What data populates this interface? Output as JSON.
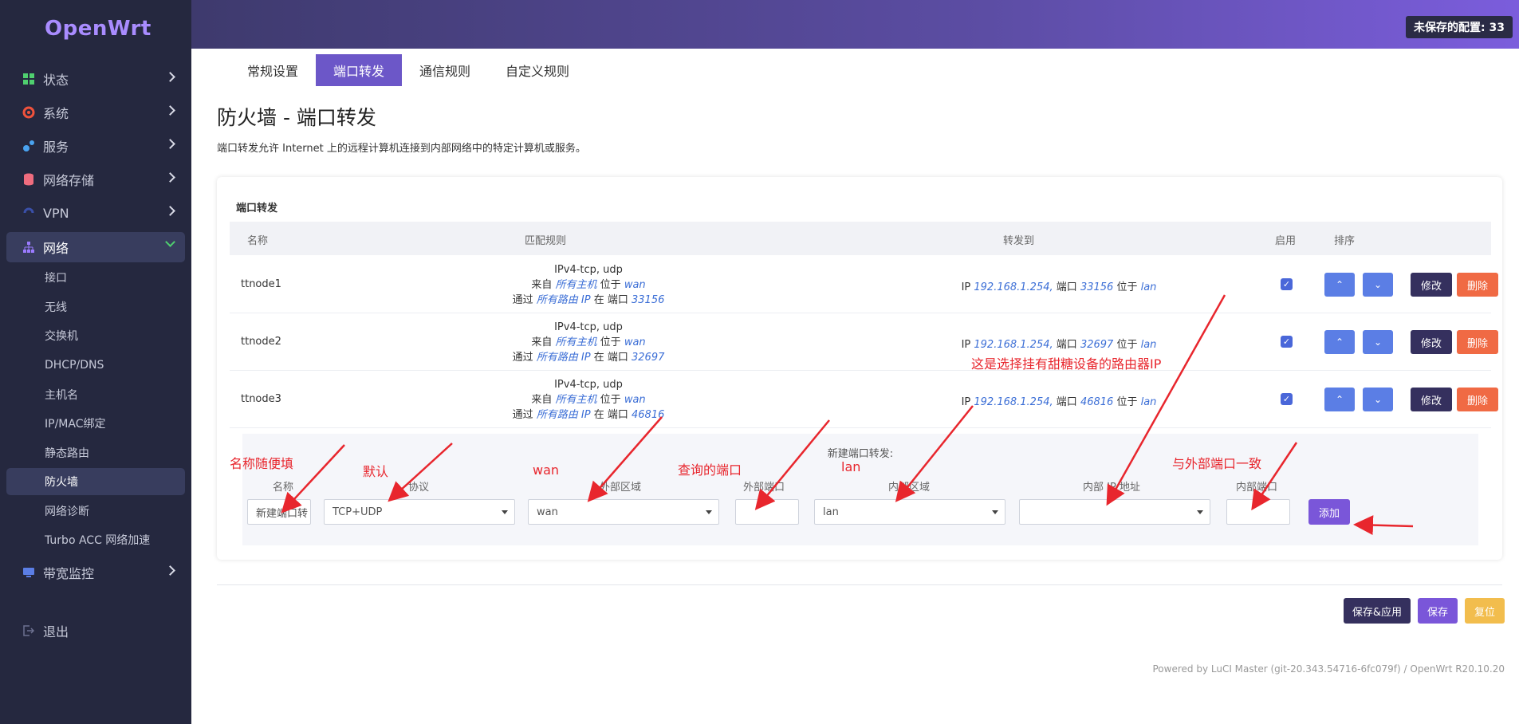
{
  "app": {
    "logo": "OpenWrt",
    "unsaved": "未保存的配置: 33"
  },
  "sidebar": {
    "items": [
      {
        "label": "状态",
        "icon": "dashboard-icon",
        "color": "#4fd06f"
      },
      {
        "label": "系统",
        "icon": "gear-icon",
        "color": "#f0523c"
      },
      {
        "label": "服务",
        "icon": "services-icon",
        "color": "#4aa3f0"
      },
      {
        "label": "网络存储",
        "icon": "storage-icon",
        "color": "#ef6c7e"
      },
      {
        "label": "VPN",
        "icon": "vpn-icon",
        "color": "#3a4fa8"
      },
      {
        "label": "网络",
        "icon": "network-icon",
        "color": "#9b7bff"
      },
      {
        "label": "带宽监控",
        "icon": "monitor-icon",
        "color": "#5b7ee5"
      },
      {
        "label": "退出",
        "icon": "logout-icon",
        "color": "#6d7190"
      }
    ],
    "subitems": [
      "接口",
      "无线",
      "交换机",
      "DHCP/DNS",
      "主机名",
      "IP/MAC绑定",
      "静态路由",
      "防火墙",
      "网络诊断",
      "Turbo ACC 网络加速"
    ]
  },
  "tabs": [
    "常规设置",
    "端口转发",
    "通信规则",
    "自定义规则"
  ],
  "page": {
    "title": "防火墙 - 端口转发",
    "description": "端口转发允许 Internet 上的远程计算机连接到内部网络中的特定计算机或服务。"
  },
  "section": {
    "title": "端口转发",
    "headers": {
      "name": "名称",
      "match": "匹配规则",
      "forward": "转发到",
      "enable": "启用",
      "sort": "排序"
    },
    "rows": [
      {
        "name": "ttnode1",
        "proto": "IPv4-tcp, udp",
        "m_from_pre": "来自",
        "m_from_host": "所有主机",
        "m_from_mid": "位于",
        "m_from_zone": "wan",
        "m_via_pre": "通过",
        "m_via_ip": "所有路由 IP",
        "m_via_mid": "在 端口",
        "m_via_port": "33156",
        "f_pre": "IP",
        "f_ip": "192.168.1.254,",
        "f_mid": "端口",
        "f_port": "33156",
        "f_at": "位于",
        "f_zone": "lan"
      },
      {
        "name": "ttnode2",
        "proto": "IPv4-tcp, udp",
        "m_from_pre": "来自",
        "m_from_host": "所有主机",
        "m_from_mid": "位于",
        "m_from_zone": "wan",
        "m_via_pre": "通过",
        "m_via_ip": "所有路由 IP",
        "m_via_mid": "在 端口",
        "m_via_port": "32697",
        "f_pre": "IP",
        "f_ip": "192.168.1.254,",
        "f_mid": "端口",
        "f_port": "32697",
        "f_at": "位于",
        "f_zone": "lan"
      },
      {
        "name": "ttnode3",
        "proto": "IPv4-tcp, udp",
        "m_from_pre": "来自",
        "m_from_host": "所有主机",
        "m_from_mid": "位于",
        "m_from_zone": "wan",
        "m_via_pre": "通过",
        "m_via_ip": "所有路由 IP",
        "m_via_mid": "在 端口",
        "m_via_port": "46816",
        "f_pre": "IP",
        "f_ip": "192.168.1.254,",
        "f_mid": "端口",
        "f_port": "46816",
        "f_at": "位于",
        "f_zone": "lan"
      }
    ],
    "buttons": {
      "up": "⌃",
      "down": "⌄",
      "edit": "修改",
      "delete": "删除"
    }
  },
  "new_rule": {
    "title": "新建端口转发:",
    "labels": {
      "name": "名称",
      "proto": "协议",
      "ext_zone": "外部区域",
      "ext_port": "外部端口",
      "int_zone": "内部区域",
      "int_ip": "内部 IP 地址",
      "int_port": "内部端口"
    },
    "name_placeholder": "新建端口转",
    "proto_value": "TCP+UDP",
    "ext_zone_value": "wan",
    "int_zone_value": "lan",
    "add": "添加"
  },
  "annotations": {
    "name": "名称随便填",
    "proto": "默认",
    "wan": "wan",
    "port": "查询的端口",
    "lan": "lan",
    "ip": "这是选择挂有甜糖设备的路由器IP",
    "intport": "与外部端口一致"
  },
  "actions": {
    "save_apply": "保存&应用",
    "save": "保存",
    "reset": "复位"
  },
  "footer": "Powered by LuCI Master (git-20.343.54716-6fc079f) / OpenWrt R20.10.20",
  "colors": {
    "accent": "#6c57c8",
    "sidebar": "#25283f",
    "delete": "#f06a44",
    "edit": "#35305e",
    "annotation": "#e8262d"
  }
}
